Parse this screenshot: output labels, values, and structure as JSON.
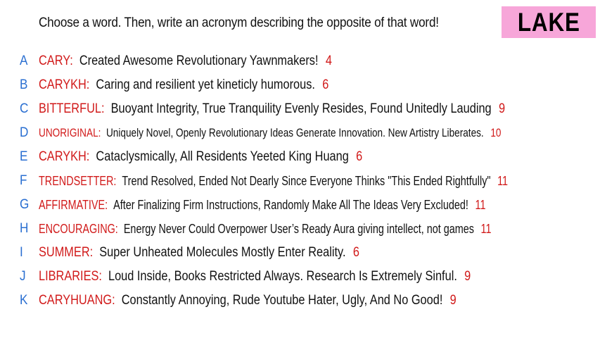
{
  "prompt": "Choose a word. Then, write an acronym describing the opposite of that word!",
  "target_word": "LAKE",
  "colors": {
    "letter": "#2a6fd1",
    "word": "#d11a1a",
    "score": "#d11a1a",
    "word_box": "#f7a6d9"
  },
  "entries": [
    {
      "letter": "A",
      "word": "CARY:",
      "acronym": "Created Awesome Revolutionary Yawnmakers!",
      "score": "4"
    },
    {
      "letter": "B",
      "word": "CARYKH:",
      "acronym": "Caring and resilient yet kineticly humorous.",
      "score": "6"
    },
    {
      "letter": "C",
      "word": "BITTERFUL:",
      "acronym": "Buoyant Integrity, True Tranquility Evenly Resides, Found Unitedly Lauding",
      "score": "9"
    },
    {
      "letter": "D",
      "word": "UNORIGINAL:",
      "acronym": "Uniquely Novel, Openly Revolutionary Ideas Generate Innovation. New Artistry Liberates.",
      "score": "10"
    },
    {
      "letter": "E",
      "word": "CARYKH:",
      "acronym": "Cataclysmically, All Residents Yeeted King Huang",
      "score": "6"
    },
    {
      "letter": "F",
      "word": "TRENDSETTER:",
      "acronym": "Trend Resolved, Ended Not Dearly Since Everyone Thinks \"This Ended Rightfully\"",
      "score": "11"
    },
    {
      "letter": "G",
      "word": "AFFIRMATIVE:",
      "acronym": "After Finalizing Firm Instructions, Randomly Make All The Ideas Very Excluded!",
      "score": "11"
    },
    {
      "letter": "H",
      "word": "ENCOURAGING:",
      "acronym": "Energy Never Could Overpower User’s Ready Aura giving intellect, not games",
      "score": "11"
    },
    {
      "letter": "I",
      "word": "SUMMER:",
      "acronym": "Super Unheated Molecules Mostly Enter Reality.",
      "score": "6"
    },
    {
      "letter": "J",
      "word": "LIBRARIES:",
      "acronym": "Loud Inside, Books Restricted Always. Research Is Extremely Sinful.",
      "score": "9"
    },
    {
      "letter": "K",
      "word": "CARYHUANG:",
      "acronym": "Constantly Annoying, Rude Youtube Hater, Ugly, And No Good!",
      "score": "9"
    }
  ]
}
